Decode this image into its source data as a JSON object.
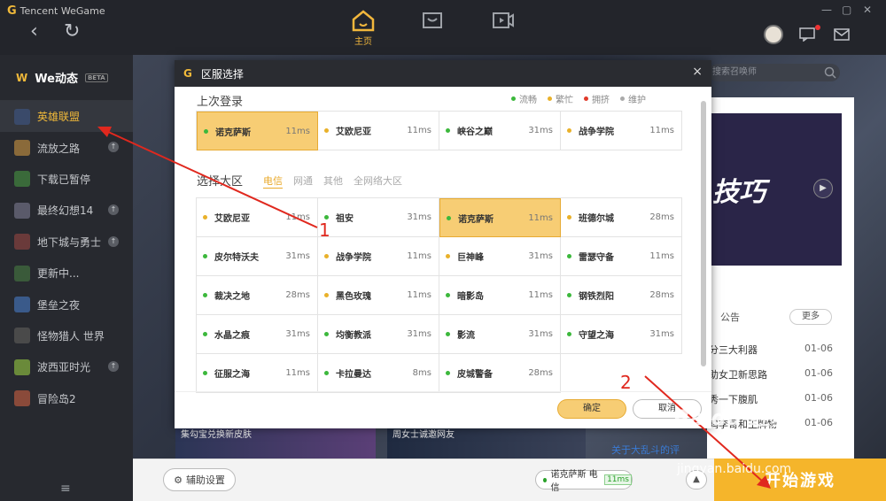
{
  "app": {
    "brand": "Tencent WeGame",
    "logo_letter": "G"
  },
  "topnav": {
    "home_label": "主页"
  },
  "sidebar": {
    "header": {
      "logo": "W",
      "title": "We动态",
      "badge": "BETA"
    },
    "items": [
      {
        "label": "英雄联盟",
        "color": "#3a4a6a",
        "active": true
      },
      {
        "label": "流放之路",
        "color": "#8a6a3a",
        "update": "↑"
      },
      {
        "label": "下载已暂停",
        "color": "#3a6a3a"
      },
      {
        "label": "最终幻想14",
        "color": "#5a5a6a",
        "update": "↑"
      },
      {
        "label": "地下城与勇士",
        "color": "#6a3a3a",
        "update": "↑"
      },
      {
        "label": "更新中...",
        "color": "#3a5a3a"
      },
      {
        "label": "堡垒之夜",
        "color": "#3a5a8a"
      },
      {
        "label": "怪物猎人 世界",
        "color": "#4a4a4a"
      },
      {
        "label": "波西亚时光",
        "color": "#6a8a3a",
        "update": "↑"
      },
      {
        "label": "冒险岛2",
        "color": "#8a4a3a"
      }
    ],
    "bottom_icon": "≡"
  },
  "main": {
    "search_placeholder": "搜索召唤师",
    "banner_text": "技巧",
    "notice_tab": "公告",
    "more_label": "更多",
    "news": [
      {
        "title": "分三大利器",
        "date": "01-06"
      },
      {
        "title": "助女卫新思路",
        "date": "01-06"
      },
      {
        "title": "秀一下腹肌",
        "date": "01-06"
      },
      {
        "title": "鸡李哥和王牌物",
        "date": "01-06"
      }
    ],
    "news_link": "关于大乱斗的评",
    "card1_caption": "集勾宝兑换新皮肤",
    "card2_caption": "周女士诚邀网友"
  },
  "bottombar": {
    "assist_label": "辅助设置",
    "server": "诺克萨斯 电信",
    "server_ms": "11ms",
    "caret": "▲",
    "start_label": "开始游戏"
  },
  "dialog": {
    "title": "区服选择",
    "close": "×",
    "recent_title": "上次登录",
    "legend": [
      {
        "label": "流畅",
        "color": "#3cb83c"
      },
      {
        "label": "繁忙",
        "color": "#e9b12a"
      },
      {
        "label": "拥挤",
        "color": "#e03a2a"
      },
      {
        "label": "维护",
        "color": "#aaaaaa"
      }
    ],
    "recent": [
      {
        "name": "诺克萨斯",
        "ms": "11ms",
        "color": "#3cb83c",
        "selected": true
      },
      {
        "name": "艾欧尼亚",
        "ms": "11ms",
        "color": "#e9b12a"
      },
      {
        "name": "峡谷之巅",
        "ms": "31ms",
        "color": "#3cb83c"
      },
      {
        "name": "战争学院",
        "ms": "11ms",
        "color": "#e9b12a"
      }
    ],
    "select_title": "选择大区",
    "filters": [
      "电信",
      "网通",
      "其他",
      "全网络大区"
    ],
    "servers": [
      {
        "name": "艾欧尼亚",
        "ms": "11ms",
        "color": "#e9b12a"
      },
      {
        "name": "祖安",
        "ms": "31ms",
        "color": "#3cb83c"
      },
      {
        "name": "诺克萨斯",
        "ms": "11ms",
        "color": "#3cb83c",
        "selected": true
      },
      {
        "name": "班德尔城",
        "ms": "28ms",
        "color": "#e9b12a"
      },
      {
        "name": "皮尔特沃夫",
        "ms": "31ms",
        "color": "#3cb83c"
      },
      {
        "name": "战争学院",
        "ms": "11ms",
        "color": "#e9b12a"
      },
      {
        "name": "巨神峰",
        "ms": "31ms",
        "color": "#e9b12a"
      },
      {
        "name": "雷瑟守备",
        "ms": "11ms",
        "color": "#3cb83c"
      },
      {
        "name": "裁决之地",
        "ms": "28ms",
        "color": "#3cb83c"
      },
      {
        "name": "黑色玫瑰",
        "ms": "11ms",
        "color": "#e9b12a"
      },
      {
        "name": "暗影岛",
        "ms": "11ms",
        "color": "#3cb83c"
      },
      {
        "name": "钢铁烈阳",
        "ms": "28ms",
        "color": "#3cb83c"
      },
      {
        "name": "水晶之痕",
        "ms": "31ms",
        "color": "#3cb83c"
      },
      {
        "name": "均衡教派",
        "ms": "31ms",
        "color": "#3cb83c"
      },
      {
        "name": "影流",
        "ms": "31ms",
        "color": "#3cb83c"
      },
      {
        "name": "守望之海",
        "ms": "31ms",
        "color": "#3cb83c"
      },
      {
        "name": "征服之海",
        "ms": "11ms",
        "color": "#3cb83c"
      },
      {
        "name": "卡拉曼达",
        "ms": "8ms",
        "color": "#3cb83c"
      },
      {
        "name": "皮城警备",
        "ms": "28ms",
        "color": "#3cb83c"
      }
    ],
    "ok_label": "确定",
    "cancel_label": "取消"
  },
  "annotations": {
    "label1": "1",
    "label2": "2",
    "watermark": "Baidu 经验",
    "watermark_url": "jingyan.baidu.com"
  }
}
